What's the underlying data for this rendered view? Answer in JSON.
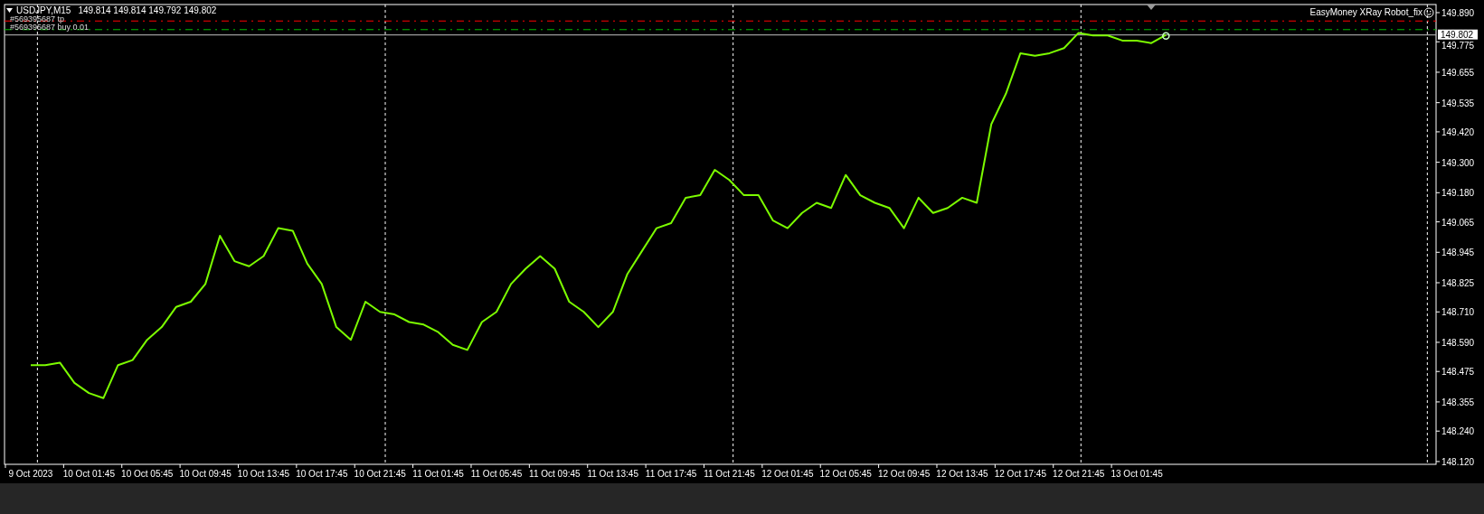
{
  "chart": {
    "symbol_label": "USDJPY,M15",
    "ohlc": [
      "149.814",
      "149.814",
      "149.792",
      "149.802"
    ],
    "expert": "EasyMoney XRay Robot_fix",
    "current_price": "149.802",
    "chart_data": {
      "type": "line",
      "ylim": [
        148.109,
        149.922
      ],
      "grid": true,
      "yticks": [
        {
          "value": 149.89,
          "label": "149.890"
        },
        {
          "value": 149.775,
          "label": "149.775"
        },
        {
          "value": 149.655,
          "label": "149.655"
        },
        {
          "value": 149.535,
          "label": "149.535"
        },
        {
          "value": 149.42,
          "label": "149.420"
        },
        {
          "value": 149.3,
          "label": "149.300"
        },
        {
          "value": 149.18,
          "label": "149.180"
        },
        {
          "value": 149.065,
          "label": "149.065"
        },
        {
          "value": 148.945,
          "label": "148.945"
        },
        {
          "value": 148.825,
          "label": "148.825"
        },
        {
          "value": 148.71,
          "label": "148.710"
        },
        {
          "value": 148.59,
          "label": "148.590"
        },
        {
          "value": 148.475,
          "label": "148.475"
        },
        {
          "value": 148.355,
          "label": "148.355"
        },
        {
          "value": 148.24,
          "label": "148.240"
        },
        {
          "value": 148.12,
          "label": "148.120"
        }
      ],
      "categories": [
        "9 Oct 2023",
        null,
        null,
        null,
        "10 Oct 01:45",
        null,
        null,
        null,
        "10 Oct 05:45",
        null,
        null,
        null,
        "10 Oct 09:45",
        null,
        null,
        null,
        "10 Oct 13:45",
        null,
        null,
        null,
        "10 Oct 17:45",
        null,
        null,
        null,
        "10 Oct 21:45",
        null,
        null,
        null,
        "11 Oct 01:45",
        null,
        null,
        null,
        "11 Oct 05:45",
        null,
        null,
        null,
        "11 Oct 09:45",
        null,
        null,
        null,
        "11 Oct 13:45",
        null,
        null,
        null,
        "11 Oct 17:45",
        null,
        null,
        null,
        "11 Oct 21:45",
        null,
        null,
        null,
        "12 Oct 01:45",
        null,
        null,
        null,
        "12 Oct 05:45",
        null,
        null,
        null,
        "12 Oct 09:45",
        null,
        null,
        null,
        "12 Oct 13:45",
        null,
        null,
        null,
        "12 Oct 17:45",
        null,
        null,
        null,
        "12 Oct 21:45",
        null,
        null,
        null,
        "13 Oct 01:45",
        null,
        null
      ],
      "series": [
        {
          "color": "#7cfc00",
          "values": [
            148.5,
            148.5,
            148.51,
            148.43,
            148.39,
            148.37,
            148.5,
            148.52,
            148.6,
            148.65,
            148.73,
            148.75,
            148.82,
            149.01,
            148.91,
            148.89,
            148.93,
            149.04,
            149.03,
            148.9,
            148.82,
            148.65,
            148.6,
            148.75,
            148.71,
            148.7,
            148.67,
            148.66,
            148.63,
            148.58,
            148.56,
            148.67,
            148.71,
            148.82,
            148.88,
            148.93,
            148.88,
            148.75,
            148.71,
            148.65,
            148.71,
            148.86,
            148.95,
            149.04,
            149.06,
            149.16,
            149.17,
            149.27,
            149.23,
            149.17,
            149.17,
            149.07,
            149.04,
            149.1,
            149.14,
            149.12,
            149.25,
            149.17,
            149.14,
            149.12,
            149.04,
            149.16,
            149.1,
            149.12,
            149.16,
            149.14,
            149.45,
            149.57,
            149.73,
            149.72,
            149.73,
            149.75,
            149.81,
            149.8,
            149.8,
            149.78,
            149.78,
            149.77,
            149.802
          ]
        }
      ],
      "ref_lines": [
        {
          "axis": "y",
          "value": 149.857,
          "color": "#ff0000",
          "label": "#569395687 tp"
        },
        {
          "axis": "y",
          "value": 149.823,
          "color": "#00c000",
          "label": "#569395687 buy 0.01"
        },
        {
          "axis": "y",
          "value": 149.802,
          "color": "#c0c0c0"
        }
      ]
    }
  }
}
